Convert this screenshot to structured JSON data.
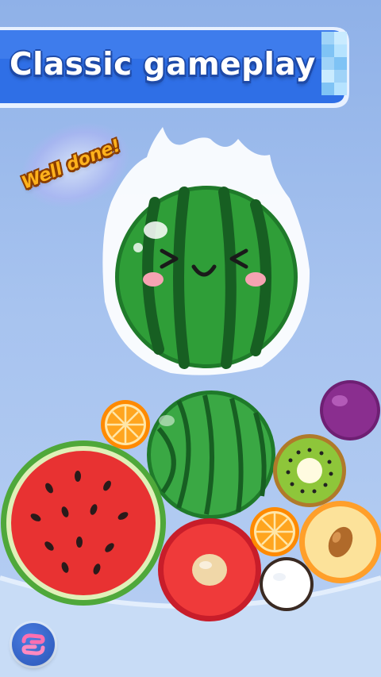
{
  "banner": {
    "title": "Classic gameplay",
    "color": "#2f6fe6",
    "shadow_color": "#1e4aa8"
  },
  "feedback": {
    "text": "Well done!",
    "color": "#ffb21c"
  },
  "game": {
    "dropping_fruit": "watermelon-with-face",
    "fruits_in_container": [
      "orange",
      "watermelon",
      "plum",
      "kiwi",
      "cut-watermelon",
      "orange",
      "peach",
      "pitaya",
      "coconut"
    ],
    "button_icon": "swap-icon"
  },
  "colors": {
    "background": "#a7c3ef",
    "watermelon_green": "#2f9e38",
    "orange": "#ff9b10",
    "plum": "#8a2e8f",
    "kiwi_green": "#8ec63a",
    "peach": "#fce29a",
    "pitaya_red": "#e32b2b"
  }
}
